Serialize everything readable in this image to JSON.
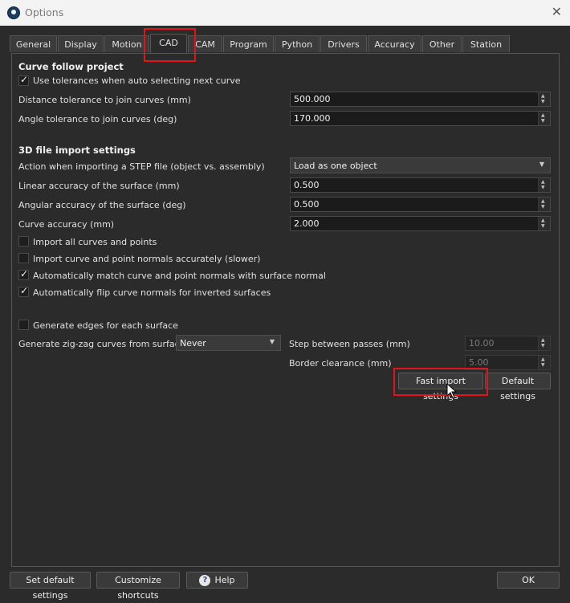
{
  "window": {
    "title": "Options",
    "close_label": "✕"
  },
  "tabs": [
    "General",
    "Display",
    "Motion",
    "CAD",
    "CAM",
    "Program",
    "Python",
    "Drivers",
    "Accuracy",
    "Other",
    "Station"
  ],
  "active_tab": "CAD",
  "curve_follow": {
    "heading": "Curve follow project",
    "use_tolerances": {
      "label": "Use tolerances when auto selecting next curve",
      "checked": true
    },
    "distance_tol": {
      "label": "Distance tolerance to join curves (mm)",
      "value": "500.000"
    },
    "angle_tol": {
      "label": "Angle tolerance to join curves (deg)",
      "value": "170.000"
    }
  },
  "import_3d": {
    "heading": "3D file import settings",
    "step_action": {
      "label": "Action when importing a STEP file (object vs. assembly)",
      "value": "Load as one object"
    },
    "linear_acc": {
      "label": "Linear accuracy of the surface (mm)",
      "value": "0.500"
    },
    "angular_acc": {
      "label": "Angular accuracy of the surface (deg)",
      "value": "0.500"
    },
    "curve_acc": {
      "label": "Curve accuracy (mm)",
      "value": "2.000"
    },
    "import_all": {
      "label": "Import all curves and points",
      "checked": false
    },
    "import_normals": {
      "label": "Import curve and point normals accurately (slower)",
      "checked": false
    },
    "auto_match": {
      "label": "Automatically match curve and point normals with surface normal",
      "checked": true
    },
    "auto_flip": {
      "label": "Automatically flip curve normals for inverted surfaces",
      "checked": true
    },
    "gen_edges": {
      "label": "Generate edges for each surface",
      "checked": false
    },
    "zigzag": {
      "label": "Generate zig-zag curves from surfaces",
      "value": "Never"
    },
    "step_passes": {
      "label": "Step between passes (mm)",
      "value": "10.00"
    },
    "border_clear": {
      "label": "Border clearance (mm)",
      "value": "5.00"
    },
    "fast_import_label": "Fast import settings",
    "default_settings_label": "Default settings"
  },
  "footer": {
    "set_default_label": "Set default settings",
    "customize_label": "Customize shortcuts",
    "help_label": "Help",
    "ok_label": "OK"
  },
  "highlight_color": "#e0141a"
}
